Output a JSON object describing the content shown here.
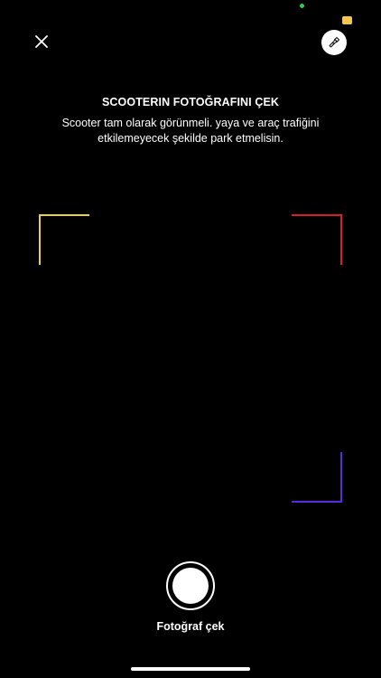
{
  "status": {
    "privacy_dot_color": "#34c759",
    "badge_color": "#f5c84b"
  },
  "toolbar": {
    "close_icon": "close-icon",
    "flash_icon": "flashlight-icon"
  },
  "header": {
    "title": "SCOOTERIN FOTOĞRAFINI ÇEK",
    "instruction": "Scooter tam olarak görünmeli.  yaya ve araç trafiğini etkilemeyecek şekilde park etmelisin."
  },
  "frame": {
    "top_left_color": "#e8d23a",
    "top_right_color": "#d92020",
    "bottom_right_color": "#5a2bd8"
  },
  "capture": {
    "label": "Fotoğraf çek"
  }
}
